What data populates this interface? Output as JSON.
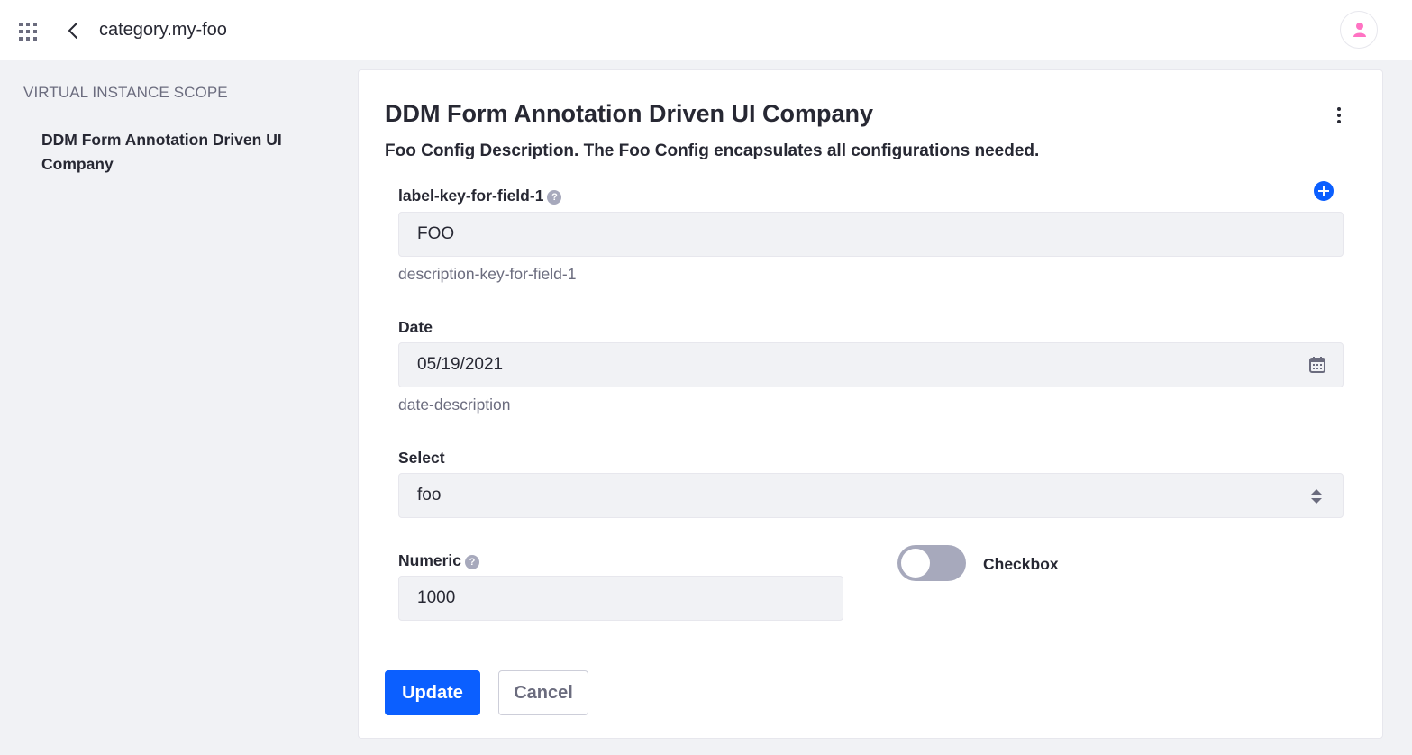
{
  "header": {
    "title": "category.my-foo"
  },
  "sidebar": {
    "scope_title": "VIRTUAL INSTANCE SCOPE",
    "items": [
      {
        "label": "DDM Form Annotation Driven UI Company"
      }
    ]
  },
  "form": {
    "title": "DDM Form Annotation Driven UI Company",
    "description": "Foo Config Description. The Foo Config encapsulates all configurations needed.",
    "field1": {
      "label": "label-key-for-field-1",
      "value": "FOO",
      "help": "description-key-for-field-1"
    },
    "date": {
      "label": "Date",
      "value": "05/19/2021",
      "help": "date-description"
    },
    "select": {
      "label": "Select",
      "value": "foo"
    },
    "numeric": {
      "label": "Numeric",
      "value": "1000"
    },
    "checkbox": {
      "label": "Checkbox",
      "checked": false
    },
    "buttons": {
      "update": "Update",
      "cancel": "Cancel"
    }
  },
  "colors": {
    "primary": "#0b5fff",
    "avatar": "#ff73c3"
  }
}
